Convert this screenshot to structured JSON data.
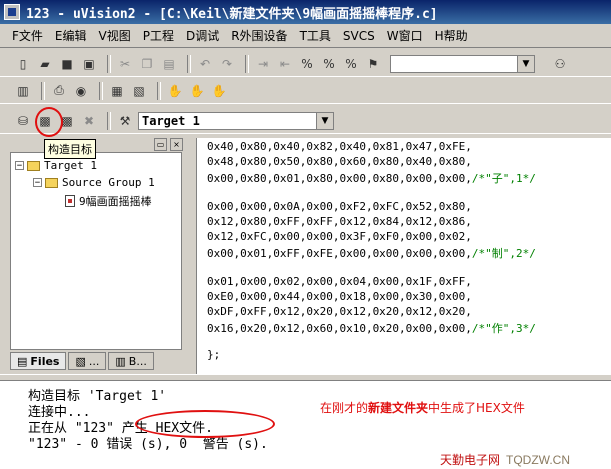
{
  "window": {
    "title": "123  - uVision2 - [C:\\Keil\\新建文件夹\\9幅画面摇摇棒程序.c]"
  },
  "menu": [
    "F文件",
    "E编辑",
    "V视图",
    "P工程",
    "D调试",
    "R外围设备",
    "T工具",
    "SVCS",
    "W窗口",
    "H帮助"
  ],
  "toolbar": {
    "find_combo_value": "",
    "target_combo_value": "Target 1",
    "tooltip": "构造目标"
  },
  "icons": {
    "row1": [
      "new-file-icon",
      "open-folder-icon",
      "save-icon",
      "save-all-icon",
      "cut-icon",
      "copy-icon",
      "paste-icon",
      "undo-icon",
      "redo-icon",
      "indent-icon",
      "unindent-icon",
      "bookmark-icon",
      "bookmark-prev-icon",
      "bookmark-next-icon",
      "find-in-files-icon",
      "binoculars-icon"
    ],
    "row2": [
      "project-icon",
      "print-icon",
      "debug-icon",
      "window-icon",
      "image-icon",
      "hand-icon",
      "hand2-icon",
      "hand3-icon"
    ],
    "row3": [
      "translate-icon",
      "build-target-icon",
      "rebuild-icon",
      "stop-build-icon",
      "options-icon"
    ]
  },
  "project_tree": {
    "target": "Target 1",
    "group": "Source Group 1",
    "file": "9幅画面摇摇棒"
  },
  "panel_tabs": [
    "Files",
    "...",
    "B..."
  ],
  "editor_lines": [
    {
      "code": "0x40,0x80,0x40,0x82,0x40,0x81,0x47,0xFE,",
      "comment": ""
    },
    {
      "code": "0x48,0x80,0x50,0x80,0x60,0x80,0x40,0x80,",
      "comment": ""
    },
    {
      "code": "0x00,0x80,0x01,0x80,0x00,0x80,0x00,0x00,",
      "comment": "/*\"子\",1*/"
    },
    {
      "code": "",
      "comment": ""
    },
    {
      "code": "0x00,0x00,0x0A,0x00,0xF2,0xFC,0x52,0x80,",
      "comment": ""
    },
    {
      "code": "0x12,0x80,0xFF,0xFF,0x12,0x84,0x12,0x86,",
      "comment": ""
    },
    {
      "code": "0x12,0xFC,0x00,0x00,0x3F,0xF0,0x00,0x02,",
      "comment": ""
    },
    {
      "code": "0x00,0x01,0xFF,0xFE,0x00,0x00,0x00,0x00,",
      "comment": "/*\"制\",2*/"
    },
    {
      "code": "",
      "comment": ""
    },
    {
      "code": "0x01,0x00,0x02,0x00,0x04,0x00,0x1F,0xFF,",
      "comment": ""
    },
    {
      "code": "0xE0,0x00,0x44,0x00,0x18,0x00,0x30,0x00,",
      "comment": ""
    },
    {
      "code": "0xDF,0xFF,0x12,0x20,0x12,0x20,0x12,0x20,",
      "comment": ""
    },
    {
      "code": "0x16,0x20,0x12,0x60,0x10,0x20,0x00,0x00,",
      "comment": "/*\"作\",3*/"
    },
    {
      "code": "",
      "comment": ""
    },
    {
      "code": "};",
      "comment": ""
    }
  ],
  "output": {
    "lines": [
      "构造目标 'Target 1'",
      "连接中...",
      "正在从 \"123\" 产生 HEX文件.",
      "\"123\" - 0 错误 (s), 0  警告 (s)."
    ],
    "annotation_pre": "在刚才的",
    "annotation_bold": "新建文件夹",
    "annotation_post": "中生成了HEX文件",
    "watermark_cn": "天勤电子网",
    "watermark_url": "TQDZW.CN"
  },
  "colors": {
    "annotation": "#e01010",
    "titlebar": "#0a246a",
    "comment": "#008000"
  }
}
